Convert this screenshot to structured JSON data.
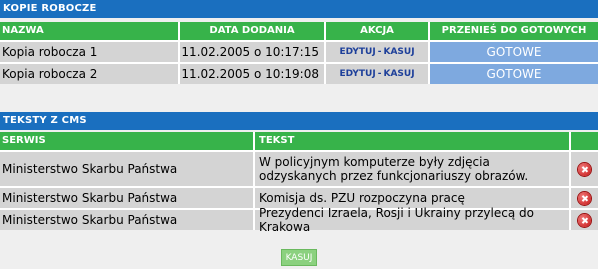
{
  "drafts": {
    "title": "KOPIE ROBOCZE",
    "headers": [
      "NAZWA",
      "DATA DODANIA",
      "AKCJA",
      "PRZENIEŚ DO GOTOWYCH"
    ],
    "rows": [
      {
        "name": "Kopia robocza 1",
        "date": "11.02.2005 o 10:17:15",
        "edit": "EDYTUJ",
        "sep": "-",
        "delete": "KASUJ",
        "done": "GOTOWE"
      },
      {
        "name": "Kopia robocza 2",
        "date": "11.02.2005 o 10:19:08",
        "edit": "EDYTUJ",
        "sep": "-",
        "delete": "KASUJ",
        "done": "GOTOWE"
      }
    ]
  },
  "cms": {
    "title": "TEKSTY Z CMS",
    "headers": [
      "SERWIS",
      "TEKST",
      ""
    ],
    "rows": [
      {
        "service": "Ministerstwo Skarbu Państwa",
        "text": "W policyjnym komputerze były zdjęcia odzyskanych przez funkcjonariuszy obrazów.",
        "icon": "delete-icon"
      },
      {
        "service": "Ministerstwo Skarbu Państwa",
        "text": "Komisja ds. PZU rozpoczyna pracę",
        "icon": "delete-icon"
      },
      {
        "service": "Ministerstwo Skarbu Państwa",
        "text": "Prezydenci Izraela, Rosji i Ukrainy przylecą do Krakowa",
        "icon": "delete-icon"
      }
    ],
    "delete_button": "KASUJ"
  },
  "colors": {
    "section_bar": "#1a6fbf",
    "header_bar": "#37b34a",
    "done_button": "#7ea9df",
    "row_bg": "#d4d4d4"
  }
}
